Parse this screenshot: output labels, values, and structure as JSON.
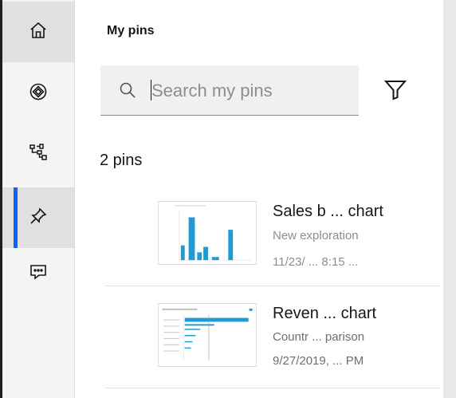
{
  "rail": {
    "items": [
      {
        "name": "home",
        "icon": "home-icon"
      },
      {
        "name": "explore",
        "icon": "compass-icon"
      },
      {
        "name": "structure",
        "icon": "tree-view-icon"
      },
      {
        "name": "pins",
        "icon": "pin-icon",
        "active": true
      },
      {
        "name": "assistant",
        "icon": "chat-icon"
      }
    ]
  },
  "panel": {
    "title": "My pins",
    "search": {
      "placeholder": "Search my pins",
      "value": ""
    },
    "count_label": "2 pins"
  },
  "pins": [
    {
      "name": "Sales b ... chart",
      "source": "New exploration",
      "date": "11/23/ ... 8:15 ..."
    },
    {
      "name": "Reven ... chart",
      "source": "Countr ... parison",
      "date": "9/27/2019, ... PM"
    }
  ],
  "colors": {
    "accent": "#0f62fe",
    "chart_bar": "#1f9ad6",
    "rail_bg": "#f4f4f4",
    "search_bg": "#f0f0f0"
  }
}
